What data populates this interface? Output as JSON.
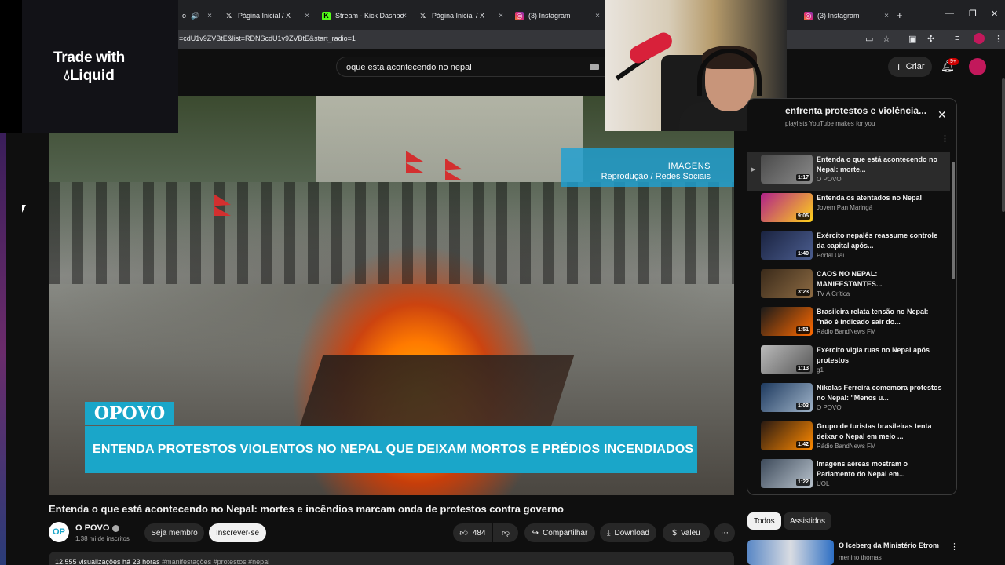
{
  "browser": {
    "tabs": [
      {
        "label": "o",
        "icon": "video-tab-icon",
        "active": true
      },
      {
        "label": "Página Inicial / X",
        "icon": "x-icon"
      },
      {
        "label": "Stream - Kick Dashbo",
        "icon": "kick-icon"
      },
      {
        "label": "Página Inicial / X",
        "icon": "x-icon"
      },
      {
        "label": "(3) Instagram",
        "icon": "instagram-icon"
      },
      {
        "label": "(3) Instagram",
        "icon": "instagram-icon"
      }
    ],
    "close_glyph": "×",
    "new_tab_glyph": "+",
    "url": "=cdU1v9ZVBtE&list=RDNScdU1v9ZVBtE&start_radio=1"
  },
  "overlay": {
    "promo_line1": "Trade with",
    "promo_brand": "Liquid"
  },
  "header": {
    "search_value": "oque esta acontecendo no nepal",
    "create_label": "Criar",
    "notification_count": "9+"
  },
  "player": {
    "credit_line1": "IMAGENS",
    "credit_line2": "Reprodução / Redes Sociais",
    "brand_tag": "OPOVO",
    "headline": "ENTENDA PROTESTOS VIOLENTOS NO NEPAL QUE DEIXAM MORTOS E PRÉDIOS INCENDIADOS"
  },
  "video": {
    "title": "Entenda o que está acontecendo no Nepal: mortes e incêndios marcam onda de protestos contra governo",
    "channel_avatar": "OP",
    "channel_name": "O POVO",
    "subscribers": "1,38 mi de inscritos",
    "member_label": "Seja membro",
    "subscribe_label": "Inscrever-se",
    "likes": "484",
    "share_label": "Compartilhar",
    "download_label": "Download",
    "thanks_label": "Valeu",
    "views_line": "12.555 visualizações  há 23 horas",
    "hashtags": "#manifestações #protestos #nepal"
  },
  "playlist": {
    "title": "enfrenta protestos e violência...",
    "subtitle": "playlists YouTube makes for you",
    "items": [
      {
        "title": "Entenda o que está acontecendo no Nepal: morte...",
        "channel": "O POVO",
        "duration": "1:17",
        "active": true
      },
      {
        "title": "Entenda os atentados no Nepal",
        "channel": "Jovem Pan Maringá",
        "duration": "9:05"
      },
      {
        "title": "Exército nepalês reassume controle da capital após...",
        "channel": "Portal Uai",
        "duration": "1:40"
      },
      {
        "title": "CAOS NO NEPAL: MANIFESTANTES...",
        "channel": "TV A Crítica",
        "duration": "3:23"
      },
      {
        "title": "Brasileira relata tensão no Nepal: \"não é indicado sair do...",
        "channel": "Rádio BandNews FM",
        "duration": "1:51"
      },
      {
        "title": "Exército vigia ruas no Nepal após protestos",
        "channel": "g1",
        "duration": "1:13"
      },
      {
        "title": "Nikolas Ferreira comemora protestos no Nepal: \"Menos u...",
        "channel": "O POVO",
        "duration": "1:03"
      },
      {
        "title": "Grupo de turistas brasileiras tenta deixar o Nepal em meio ...",
        "channel": "Rádio BandNews FM",
        "duration": "1:42"
      },
      {
        "title": "Imagens aéreas mostram o Parlamento do Nepal em...",
        "channel": "UOL",
        "duration": "1:22"
      }
    ]
  },
  "recommendations": {
    "chips": [
      "Todos",
      "Assistidos"
    ],
    "first_title": "O Iceberg da Ministério Etrom",
    "first_channel": "menino thomas"
  },
  "colors": {
    "youtube_bg": "#0f0f0f",
    "opovo_cyan": "#1aa6c9",
    "chrome_tab": "#202124",
    "chrome_toolbar": "#35363a"
  }
}
